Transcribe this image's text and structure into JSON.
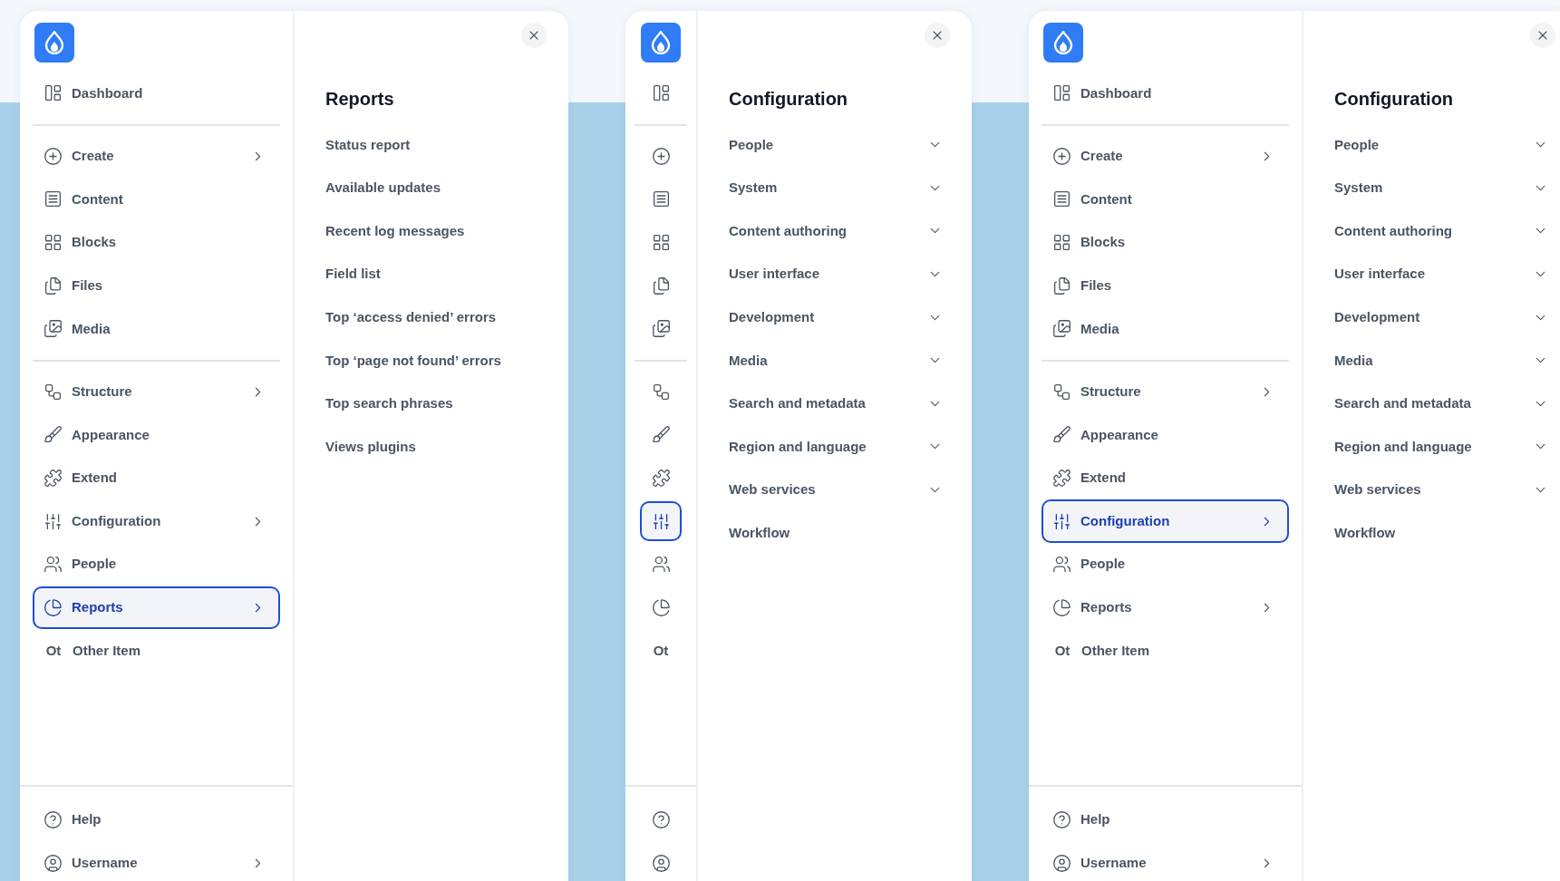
{
  "panels": [
    {
      "kind": "expanded",
      "sidebar": {
        "groups": [
          [
            {
              "label": "Dashboard",
              "has_children": false,
              "selected": false
            }
          ],
          [
            {
              "label": "Create",
              "has_children": true,
              "selected": false
            },
            {
              "label": "Content",
              "has_children": false,
              "selected": false
            },
            {
              "label": "Blocks",
              "has_children": false,
              "selected": false
            },
            {
              "label": "Files",
              "has_children": false,
              "selected": false
            },
            {
              "label": "Media",
              "has_children": false,
              "selected": false
            }
          ],
          [
            {
              "label": "Structure",
              "has_children": true,
              "selected": false
            },
            {
              "label": "Appearance",
              "has_children": false,
              "selected": false
            },
            {
              "label": "Extend",
              "has_children": false,
              "selected": false
            },
            {
              "label": "Configuration",
              "has_children": true,
              "selected": false
            },
            {
              "label": "People",
              "has_children": false,
              "selected": false
            },
            {
              "label": "Reports",
              "has_children": true,
              "selected": true
            },
            {
              "abbr": "Ot",
              "label": "Other Item",
              "has_children": false,
              "selected": false
            }
          ]
        ],
        "footer": [
          {
            "label": "Help",
            "has_children": false,
            "selected": false
          },
          {
            "label": "Username",
            "has_children": true,
            "selected": false
          }
        ]
      },
      "flyout": {
        "title": "Reports",
        "items": [
          {
            "label": "Status report",
            "expandable": false
          },
          {
            "label": "Available updates",
            "expandable": false
          },
          {
            "label": "Recent log messages",
            "expandable": false
          },
          {
            "label": "Field list",
            "expandable": false
          },
          {
            "label": "Top ‘access denied’ errors",
            "expandable": false
          },
          {
            "label": "Top ‘page not found’ errors",
            "expandable": false
          },
          {
            "label": "Top search phrases",
            "expandable": false
          },
          {
            "label": "Views plugins",
            "expandable": false
          }
        ]
      }
    },
    {
      "kind": "collapsed",
      "sidebar": {
        "groups": [
          [
            {
              "selected": false
            }
          ],
          [
            {
              "selected": false
            },
            {
              "selected": false
            },
            {
              "selected": false
            },
            {
              "selected": false
            },
            {
              "selected": false
            }
          ],
          [
            {
              "selected": false
            },
            {
              "selected": false
            },
            {
              "selected": false
            },
            {
              "selected": true
            },
            {
              "selected": false
            },
            {
              "selected": false
            },
            {
              "abbr": "Ot",
              "selected": false
            }
          ]
        ],
        "footer": [
          {
            "selected": false
          },
          {
            "selected": false
          }
        ]
      },
      "flyout": {
        "title": "Configuration",
        "items": [
          {
            "label": "People",
            "expandable": true
          },
          {
            "label": "System",
            "expandable": true
          },
          {
            "label": "Content authoring",
            "expandable": true
          },
          {
            "label": "User interface",
            "expandable": true
          },
          {
            "label": "Development",
            "expandable": true
          },
          {
            "label": "Media",
            "expandable": true
          },
          {
            "label": "Search and metadata",
            "expandable": true
          },
          {
            "label": "Region and language",
            "expandable": true
          },
          {
            "label": "Web services",
            "expandable": true
          },
          {
            "label": "Workflow",
            "expandable": false
          }
        ]
      }
    },
    {
      "kind": "expanded",
      "sidebar": {
        "groups": [
          [
            {
              "label": "Dashboard",
              "has_children": false,
              "selected": false
            }
          ],
          [
            {
              "label": "Create",
              "has_children": true,
              "selected": false
            },
            {
              "label": "Content",
              "has_children": false,
              "selected": false
            },
            {
              "label": "Blocks",
              "has_children": false,
              "selected": false
            },
            {
              "label": "Files",
              "has_children": false,
              "selected": false
            },
            {
              "label": "Media",
              "has_children": false,
              "selected": false
            }
          ],
          [
            {
              "label": "Structure",
              "has_children": true,
              "selected": false
            },
            {
              "label": "Appearance",
              "has_children": false,
              "selected": false
            },
            {
              "label": "Extend",
              "has_children": false,
              "selected": false
            },
            {
              "label": "Configuration",
              "has_children": true,
              "selected": true
            },
            {
              "label": "People",
              "has_children": false,
              "selected": false
            },
            {
              "label": "Reports",
              "has_children": true,
              "selected": false
            },
            {
              "abbr": "Ot",
              "label": "Other Item",
              "has_children": false,
              "selected": false
            }
          ]
        ],
        "footer": [
          {
            "label": "Help",
            "has_children": false,
            "selected": false
          },
          {
            "label": "Username",
            "has_children": true,
            "selected": false
          }
        ]
      },
      "flyout": {
        "title": "Configuration",
        "items": [
          {
            "label": "People",
            "expandable": true
          },
          {
            "label": "System",
            "expandable": true
          },
          {
            "label": "Content authoring",
            "expandable": true
          },
          {
            "label": "User interface",
            "expandable": true
          },
          {
            "label": "Development",
            "expandable": true
          },
          {
            "label": "Media",
            "expandable": true
          },
          {
            "label": "Search and metadata",
            "expandable": true
          },
          {
            "label": "Region and language",
            "expandable": true
          },
          {
            "label": "Web services",
            "expandable": true
          },
          {
            "label": "Workflow",
            "expandable": false
          }
        ]
      }
    }
  ]
}
